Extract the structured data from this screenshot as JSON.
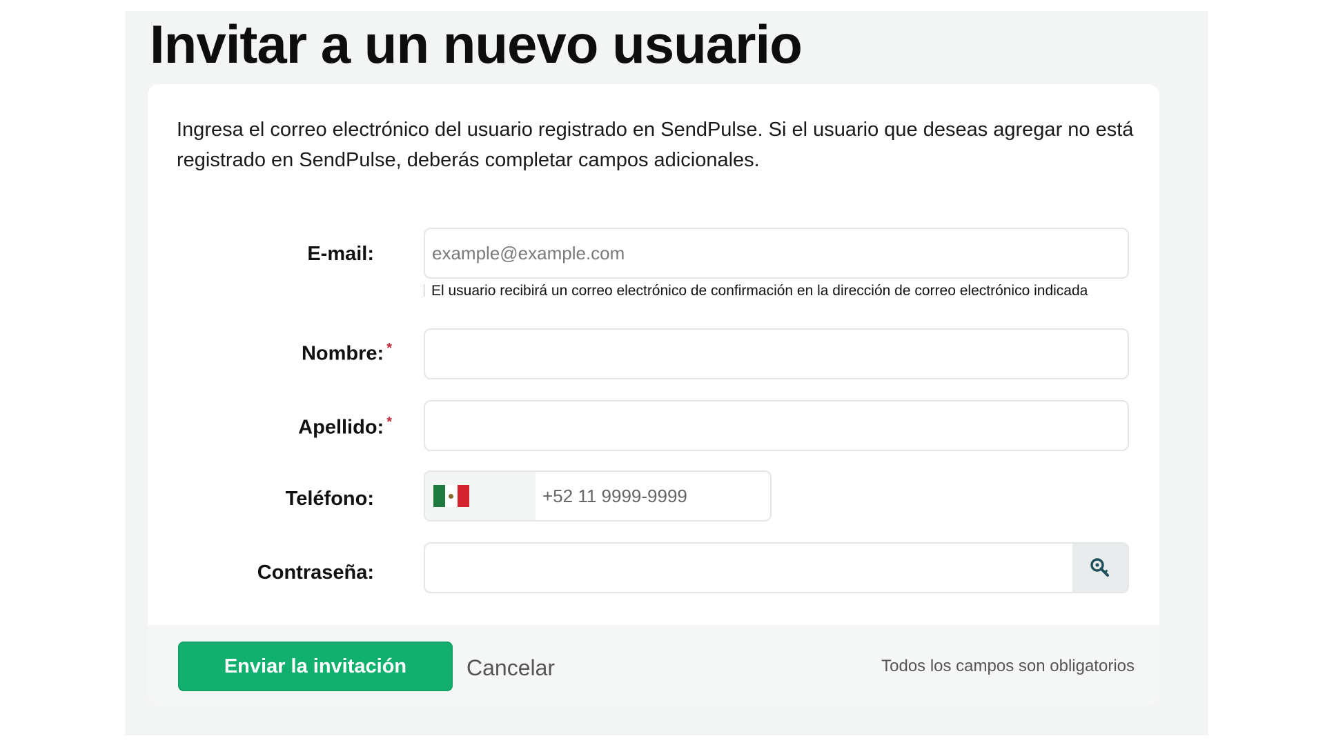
{
  "page": {
    "title": "Invitar a un nuevo usuario"
  },
  "intro": {
    "text": "Ingresa el correo electrónico del usuario registrado en SendPulse. Si el usuario que deseas agregar no está registrado en SendPulse, deberás completar campos adicionales."
  },
  "form": {
    "email": {
      "label": "E-mail:",
      "placeholder": "example@example.com",
      "value": "",
      "hint": "El usuario recibirá un correo electrónico de confirmación en la dirección de correo electrónico indicada"
    },
    "first_name": {
      "label": "Nombre:",
      "required_mark": "*",
      "value": ""
    },
    "last_name": {
      "label": "Apellido:",
      "required_mark": "*",
      "value": ""
    },
    "phone": {
      "label": "Teléfono:",
      "country_flag_icon": "mexico-flag-icon",
      "placeholder": "+52 11 9999-9999",
      "value": ""
    },
    "password": {
      "label": "Contraseña:",
      "value": "",
      "generate_icon": "key-search-icon"
    }
  },
  "footer": {
    "submit_label": "Enviar la invitación",
    "cancel_label": "Cancelar",
    "note": "Todos los campos son obligatorios"
  },
  "colors": {
    "primary": "#12b06e",
    "required": "#c0283a",
    "background": "#f3f5f4",
    "icon": "#1e4f5c"
  }
}
